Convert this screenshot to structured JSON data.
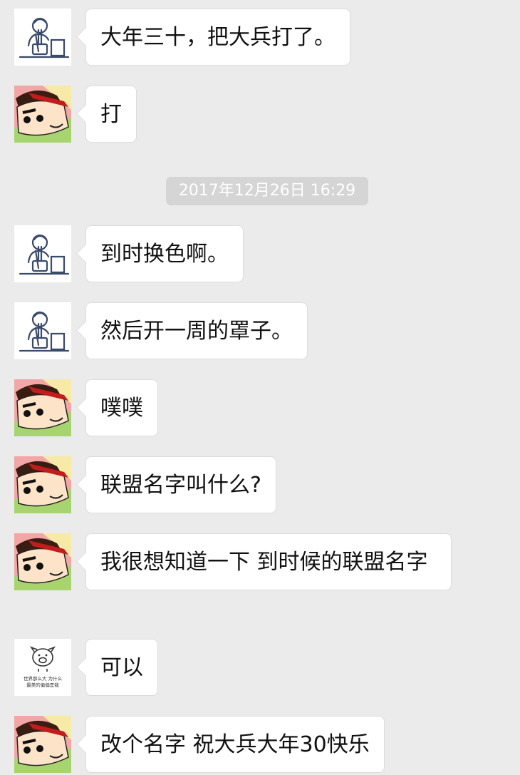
{
  "timestamp": "2017年12月26日 16:29",
  "avatars": {
    "man": "man-with-noodles-avatar",
    "shinchan": "crayon-shinchan-avatar",
    "pig": "pig-meme-avatar",
    "pig_caption_1": "世界那么大 为什么",
    "pig_caption_2": "最美的偏偏是我"
  },
  "messages": [
    {
      "sender": "man",
      "text": "大年三十，把大兵打了。"
    },
    {
      "sender": "shinchan",
      "text": "打"
    },
    {
      "sender": "man",
      "text": "到时换色啊。"
    },
    {
      "sender": "man",
      "text": "然后开一周的罩子。"
    },
    {
      "sender": "shinchan",
      "text": "噗噗"
    },
    {
      "sender": "shinchan",
      "text": "联盟名字叫什么?"
    },
    {
      "sender": "shinchan",
      "text": "我很想知道一下  到时候的联盟名字"
    },
    {
      "sender": "pig",
      "text": "可以"
    },
    {
      "sender": "shinchan",
      "text": "改个名字   祝大兵大年30快乐"
    }
  ]
}
